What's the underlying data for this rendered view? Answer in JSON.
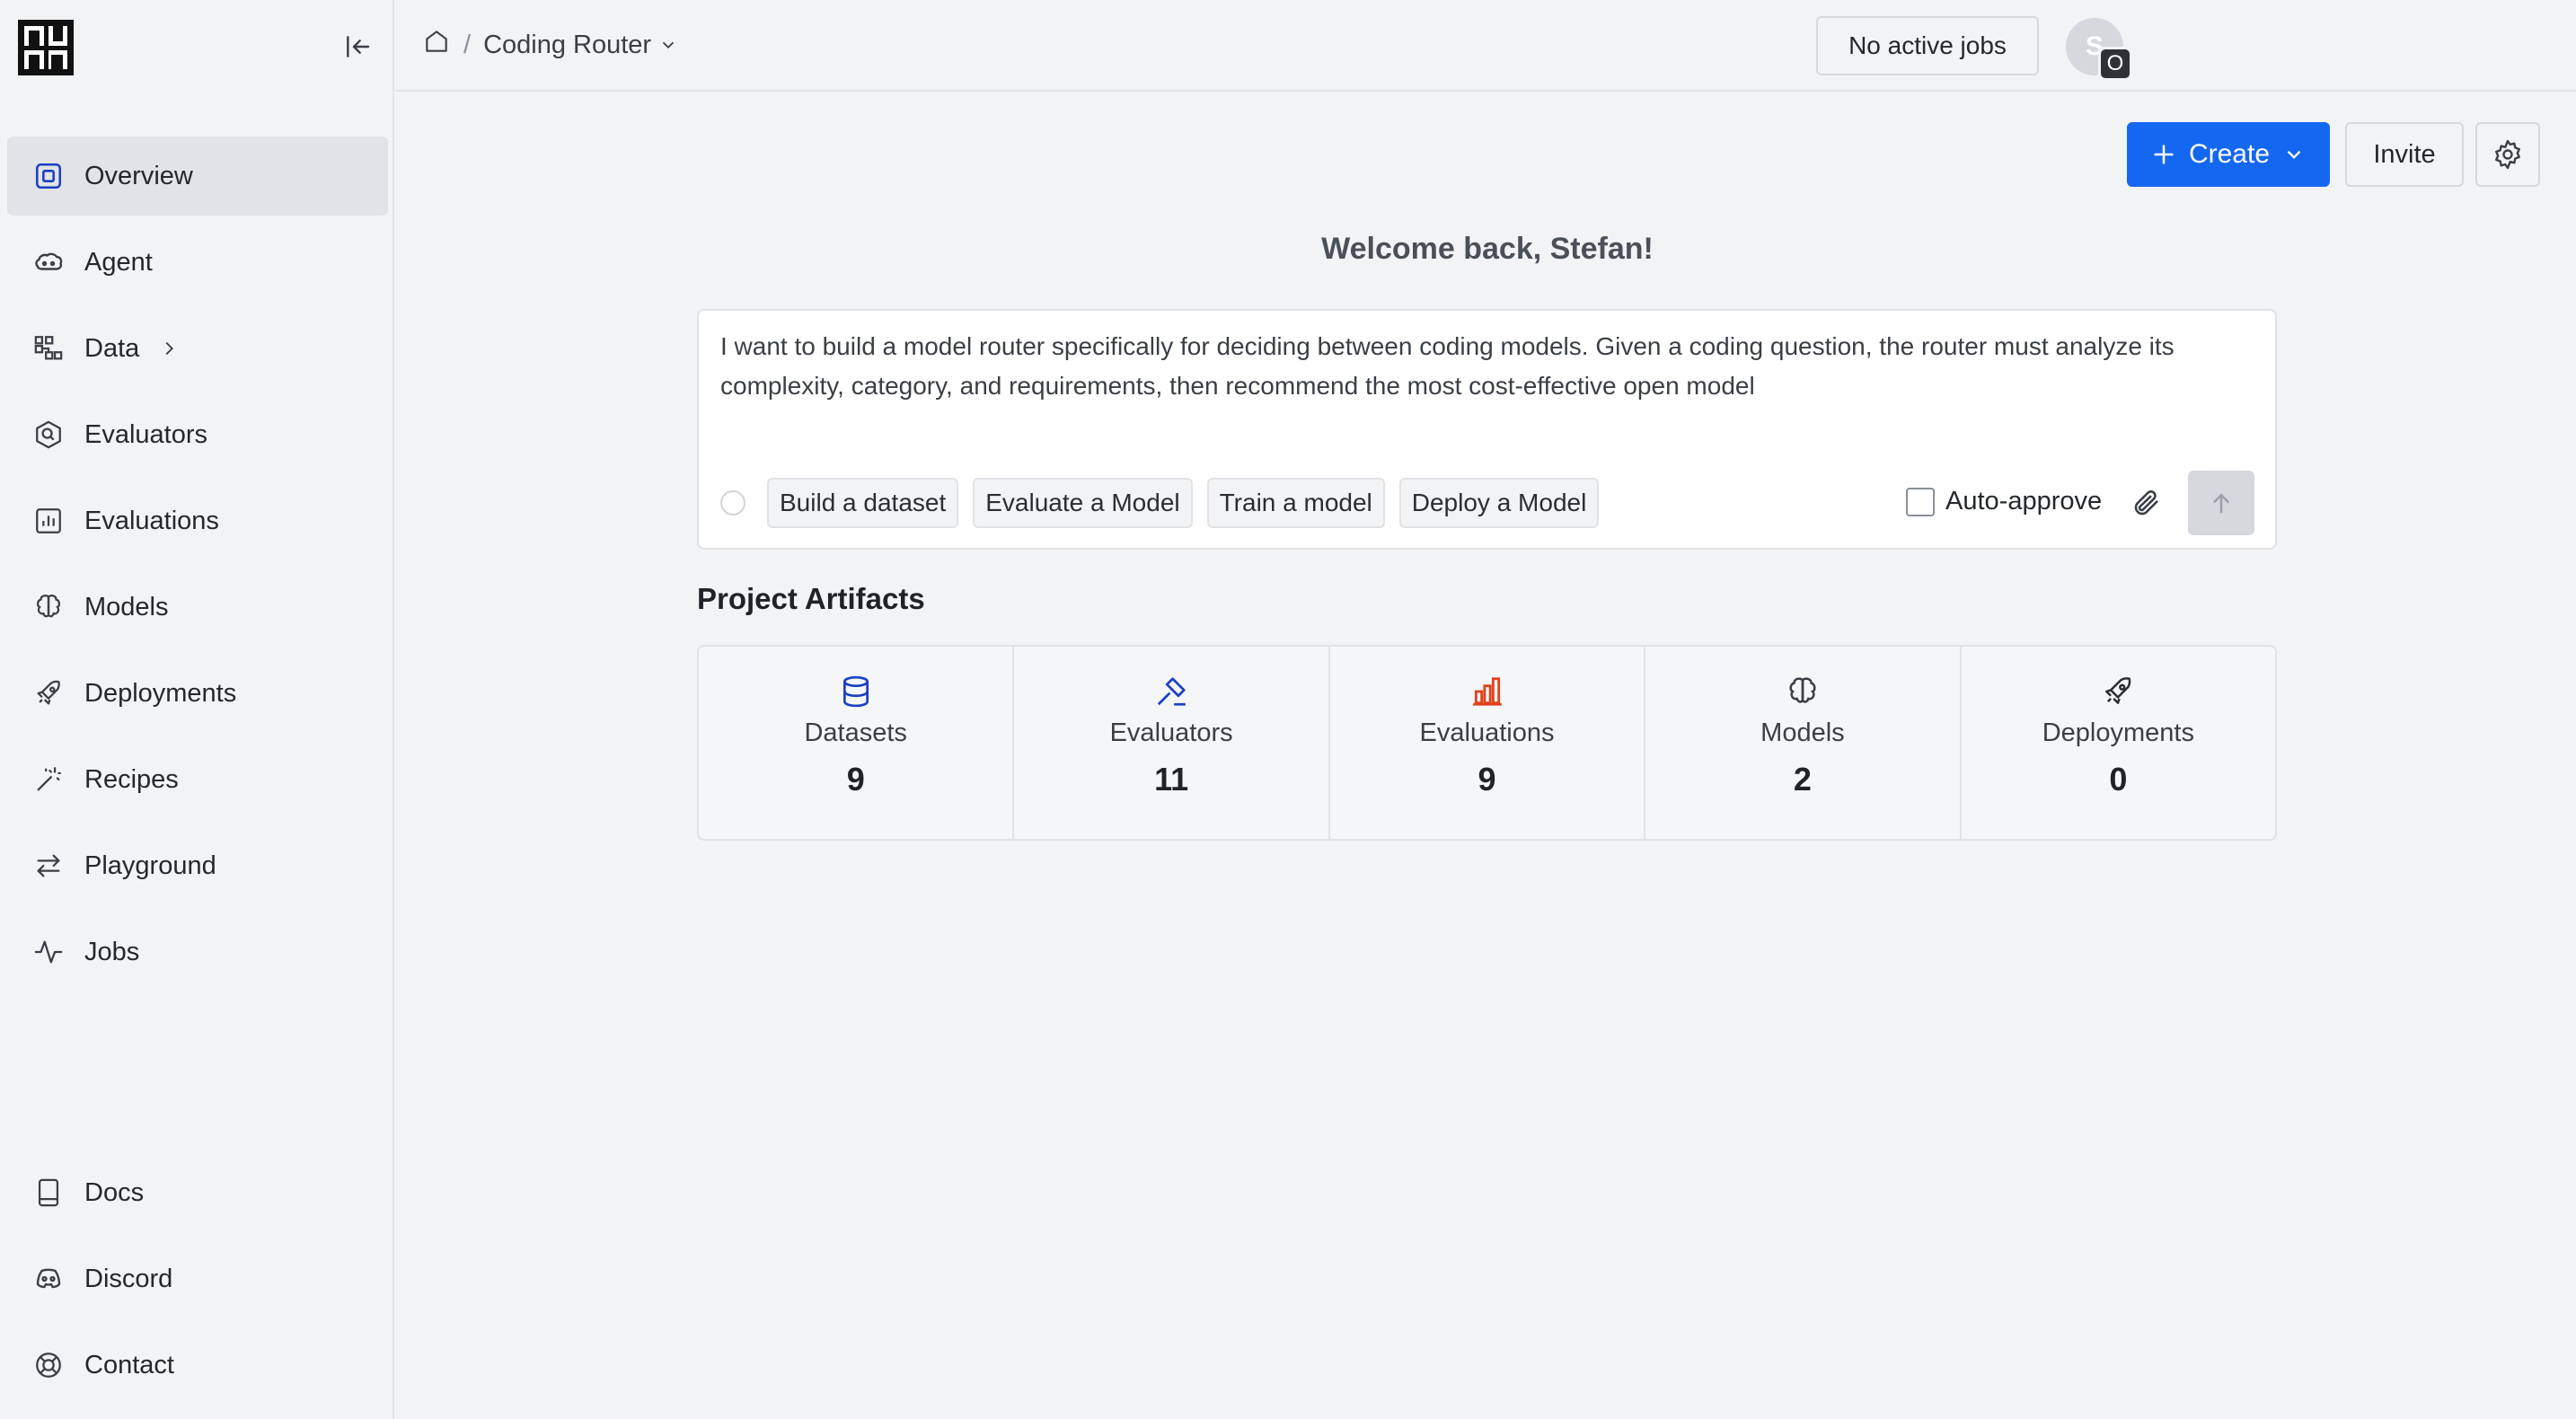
{
  "sidebar": {
    "items": [
      {
        "label": "Overview",
        "icon": "overview-icon",
        "active": true
      },
      {
        "label": "Agent",
        "icon": "agent-icon"
      },
      {
        "label": "Data",
        "icon": "data-icon",
        "expandable": true
      },
      {
        "label": "Evaluators",
        "icon": "evaluators-icon"
      },
      {
        "label": "Evaluations",
        "icon": "evaluations-icon"
      },
      {
        "label": "Models",
        "icon": "models-icon"
      },
      {
        "label": "Deployments",
        "icon": "deployments-icon"
      },
      {
        "label": "Recipes",
        "icon": "recipes-icon"
      },
      {
        "label": "Playground",
        "icon": "playground-icon"
      },
      {
        "label": "Jobs",
        "icon": "jobs-icon"
      }
    ],
    "bottom": [
      {
        "label": "Docs",
        "icon": "docs-icon"
      },
      {
        "label": "Discord",
        "icon": "discord-icon"
      },
      {
        "label": "Contact",
        "icon": "contact-icon"
      }
    ]
  },
  "header": {
    "breadcrumb_separator": "/",
    "project_name": "Coding Router",
    "jobs_status": "No active jobs",
    "avatar_initial": "S",
    "avatar_badge": "O"
  },
  "actions": {
    "create_label": "Create",
    "invite_label": "Invite"
  },
  "main": {
    "welcome": "Welcome back, Stefan!",
    "prompt_text": "I want to build a model router specifically for deciding between coding models. Given a coding question, the router must analyze its complexity, category, and requirements, then recommend the most cost-effective open model",
    "chips": [
      "Build a dataset",
      "Evaluate a Model",
      "Train a model",
      "Deploy a Model"
    ],
    "auto_approve_label": "Auto-approve",
    "auto_approve_checked": false,
    "artifacts_title": "Project Artifacts",
    "artifacts": [
      {
        "label": "Datasets",
        "count": "9",
        "icon": "database-icon",
        "color": "#1a3fc4"
      },
      {
        "label": "Evaluators",
        "count": "11",
        "icon": "gavel-icon",
        "color": "#1a3fc4"
      },
      {
        "label": "Evaluations",
        "count": "9",
        "icon": "bar-chart-icon",
        "color": "#e0421c"
      },
      {
        "label": "Models",
        "count": "2",
        "icon": "brain-icon",
        "color": "#3a3f45"
      },
      {
        "label": "Deployments",
        "count": "0",
        "icon": "rocket-icon",
        "color": "#2a2e33"
      }
    ]
  },
  "colors": {
    "accent": "#1467f0",
    "background": "#f2f3f5"
  }
}
